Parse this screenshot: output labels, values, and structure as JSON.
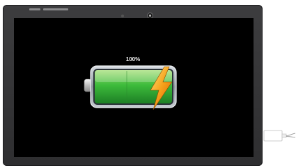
{
  "charging": {
    "percent_label": "100%",
    "level": 1.0,
    "fill_color": "#3dbb3b",
    "bolt_color": "#f6a11b"
  },
  "device": {
    "bezel_color": "#333335",
    "screen_color": "#000000"
  }
}
